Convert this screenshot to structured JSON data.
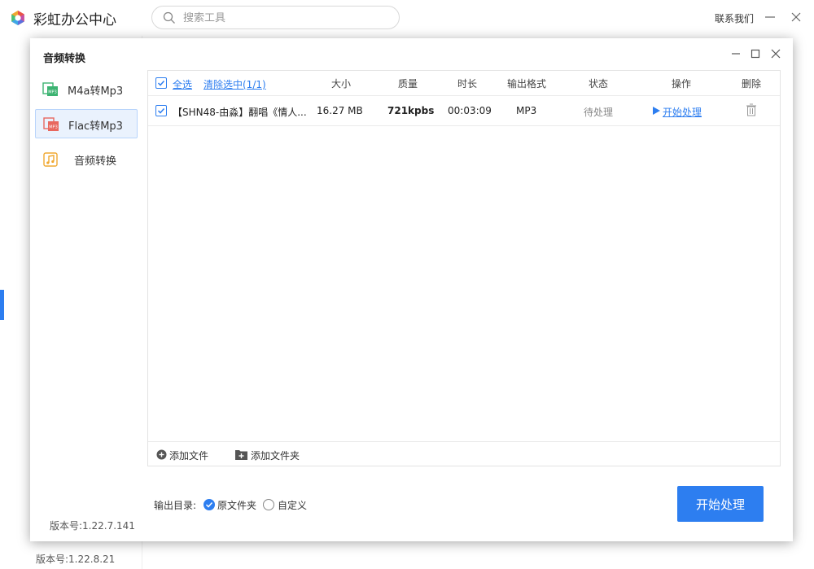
{
  "app": {
    "title": "彩虹办公中心",
    "search_placeholder": "搜索工具",
    "contact_label": "联系我们",
    "version": "版本号:1.22.8.21",
    "accent_color": "#2d7ef0"
  },
  "dialog": {
    "title": "音频转换",
    "sidebar": [
      {
        "label": "M4a转Mp3",
        "icon": "m4a-mp3-icon",
        "active": false
      },
      {
        "label": "Flac转Mp3",
        "icon": "flac-mp3-icon",
        "active": true
      },
      {
        "label": "音频转换",
        "icon": "music-note-icon",
        "active": false
      }
    ],
    "version": "版本号:1.22.7.141",
    "table": {
      "select_all": "全选",
      "clear_selected": "清除选中(1/1)",
      "headers": {
        "size": "大小",
        "quality": "质量",
        "duration": "时长",
        "format": "输出格式",
        "status": "状态",
        "action": "操作",
        "delete": "删除"
      },
      "rows": [
        {
          "name": "【SHN48-由淼】翻唱《情人...",
          "size": "16.27 MB",
          "quality": "721kpbs",
          "duration": "00:03:09",
          "format": "MP3",
          "status": "待处理",
          "action": "开始处理",
          "checked": true
        }
      ]
    },
    "footer": {
      "add_file": "添加文件",
      "add_folder": "添加文件夹"
    },
    "output": {
      "label": "输出目录:",
      "options": [
        {
          "label": "原文件夹",
          "selected": true
        },
        {
          "label": "自定义",
          "selected": false
        }
      ]
    },
    "start_button": "开始处理"
  }
}
